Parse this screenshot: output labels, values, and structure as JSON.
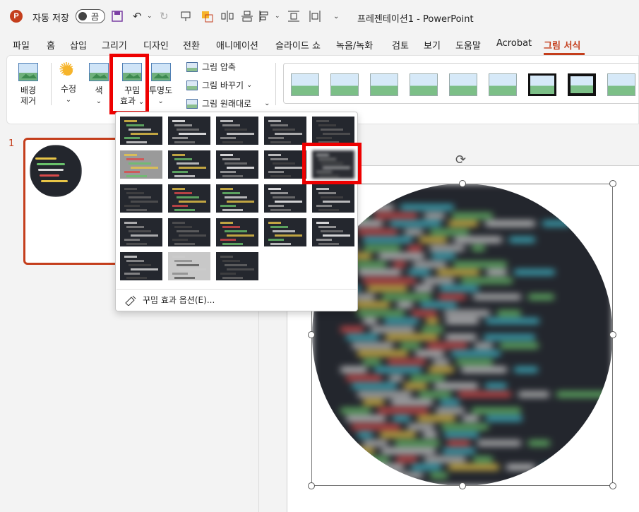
{
  "titlebar": {
    "app_logo": "P",
    "autosave_label": "자동 저장",
    "autosave_state": "끔",
    "window_title": "프레젠테이션1  -  PowerPoint"
  },
  "tabs": [
    "파일",
    "홈",
    "삽입",
    "그리기",
    "디자인",
    "전환",
    "애니메이션",
    "슬라이드 쇼",
    "녹음/녹화",
    "검토",
    "보기",
    "도움말",
    "Acrobat",
    "그림 서식"
  ],
  "active_tab": "그림 서식",
  "ribbon": {
    "remove_bg": [
      "배경",
      "제거"
    ],
    "corrections": "수정",
    "color": "색",
    "artistic_effects": [
      "꾸밈",
      "효과"
    ],
    "transparency": "투명도",
    "compress": "그림 압축",
    "change": "그림 바꾸기",
    "reset": "그림 원래대로",
    "chevron": "⌄"
  },
  "slide_panel": {
    "number": "1"
  },
  "dropdown": {
    "options_label": "꾸밈 효과 옵션(E)..."
  },
  "colors": {
    "accent": "#c43e1c",
    "highlight": "#ee0000"
  }
}
